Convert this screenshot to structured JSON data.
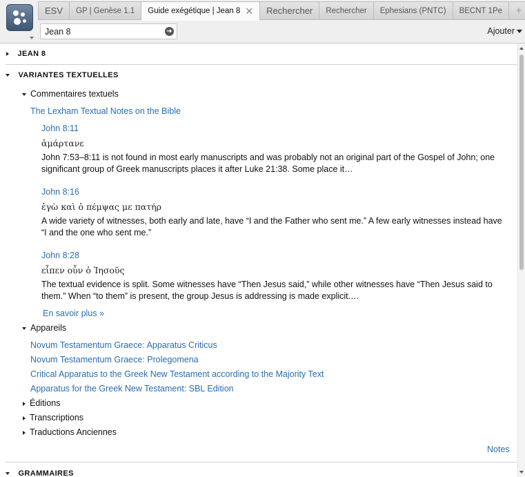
{
  "tabs": [
    {
      "label": "ESV"
    },
    {
      "label": "GP | Genèse 1.1"
    },
    {
      "label": "Guide exégétique | Jean 8"
    },
    {
      "label": "Rechercher"
    },
    {
      "label": "Rechercher"
    },
    {
      "label": "Ephesians (PNTC)"
    },
    {
      "label": "BECNT 1Pe"
    }
  ],
  "tab_add": "+",
  "tab_close": "✕",
  "reference": {
    "value": "Jean 8",
    "go_glyph": "➜"
  },
  "ajouter": "Ajouter",
  "sections": {
    "jean8": "JEAN 8",
    "variantes": "VARIANTES TEXTUELLES",
    "grammaires": "GRAMMAIRES"
  },
  "commentaires": {
    "label": "Commentaires textuels",
    "resource": "The Lexham Textual Notes on the Bible",
    "entries": [
      {
        "ref": "John 8:11",
        "greek": "ἁμάρτανε",
        "text": "John 7:53–8:11 is not found in most early manuscripts and was probably not an original part of the Gospel of John; one significant group of Greek manuscripts places it after Luke 21:38. Some place it…"
      },
      {
        "ref": "John 8:16",
        "greek": "ἐγὼ καὶ ὁ πέμψας με πατήρ",
        "text": "A wide variety of witnesses, both early and late, have “I and the Father who sent me.” A few early witnesses instead have “I and the one who sent me.”"
      },
      {
        "ref": "John 8:28",
        "greek": "εἶπεν οὖν ὁ Ἰησοῦς",
        "text": "The textual evidence is split. Some witnesses have “Then Jesus said,” while other witnesses have “Then Jesus said to them.” When “to them” is present, the group Jesus is addressing is made explicit.…"
      }
    ],
    "more": "En savoir plus »"
  },
  "appareils": {
    "label": "Appareils",
    "links": [
      "Novum Testamentum Graece: Apparatus Criticus",
      "Novum Testamentum Graece: Prolegomena",
      "Critical Apparatus to the Greek New Testament according to the Majority Text",
      "Apparatus for the Greek New Testament: SBL Edition"
    ]
  },
  "collapsed": [
    "Éditions",
    "Transcriptions",
    "Traductions Anciennes"
  ],
  "notes": "Notes",
  "colors": {
    "link": "#2a6db0",
    "logo": "#4a6283"
  }
}
